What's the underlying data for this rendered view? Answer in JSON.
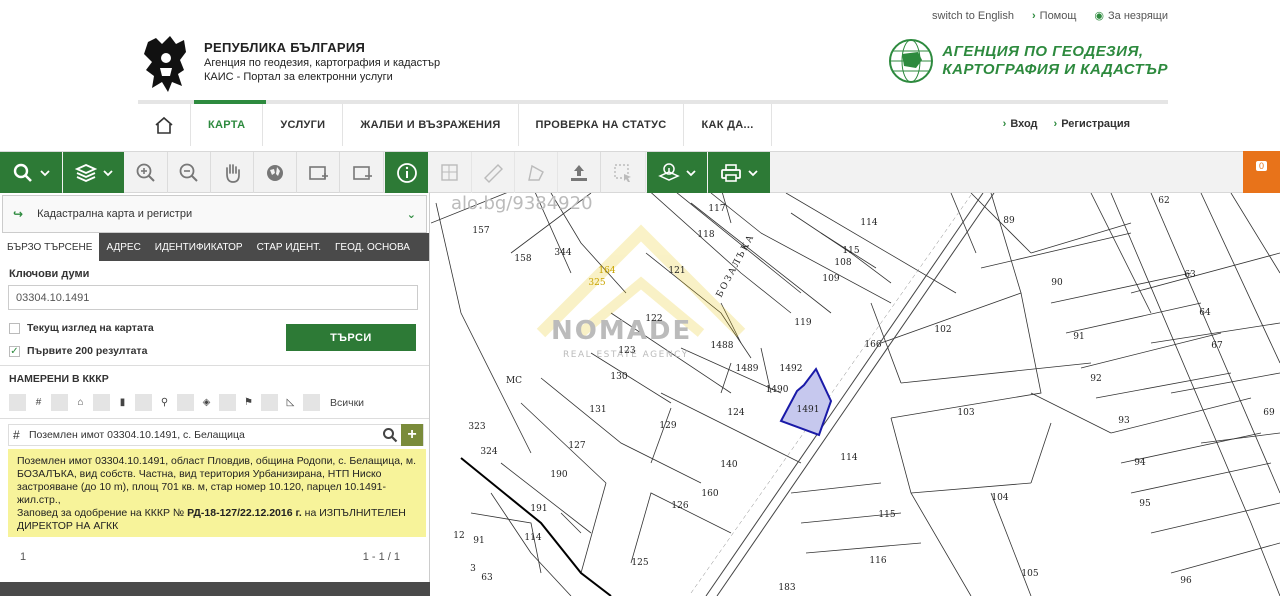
{
  "top_links": {
    "english": "switch to English",
    "help": "Помощ",
    "accessible": "За незрящи"
  },
  "brand": {
    "line1": "РЕПУБЛИКА БЪЛГАРИЯ",
    "line2": "Агенция по геодезия, картография и кадастър",
    "line3": "КАИС - Портал за електронни услуги"
  },
  "agency": {
    "line1": "АГЕНЦИЯ ПО ГЕОДЕЗИЯ,",
    "line2": "КАРТОГРАФИЯ И КАДАСТЪР"
  },
  "nav": {
    "items": [
      "КАРТА",
      "УСЛУГИ",
      "ЖАЛБИ И ВЪЗРАЖЕНИЯ",
      "ПРОВЕРКА НА СТАТУС",
      "КАК ДА..."
    ],
    "active": "КАРТА"
  },
  "auth": {
    "login": "Вход",
    "register": "Регистрация"
  },
  "toolbar": {
    "badge_count": "0"
  },
  "panel": {
    "layer": "Кадастрална карта и регистри",
    "tabs": [
      "БЪРЗО ТЪРСЕНЕ",
      "АДРЕС",
      "ИДЕНТИФИКАТОР",
      "СТАР ИДЕНТ.",
      "ГЕОД. ОСНОВА"
    ],
    "keywords_label": "Ключови думи",
    "keywords_value": "03304.10.1491",
    "check_current": "Текущ изглед на картата",
    "check_first200": "Първите 200 резултата",
    "search_button": "ТЪРСИ",
    "found_label": "НАМЕРЕНИ В КККР",
    "filter_all": "Всички",
    "result_title": "Поземлен имот 03304.10.1491, с. Белащица",
    "info_text": "Поземлен имот 03304.10.1491, област Пловдив, община Родопи, с. Белащица, м. БОЗАЛЪКА, вид собств. Частна, вид територия Урбанизирана, НТП Ниско застрояване (до 10 m), площ 701 кв. м, стар номер 10.120, парцел 10.1491-жил.стр.,",
    "info_order_prefix": "Заповед за одобрение на КККР №",
    "info_order_no": "РД-18-127/22.12.2016 г.",
    "info_order_suffix": "на ИЗПЪЛНИТЕЛЕН ДИРЕКТОР НА АГКК",
    "page": "1",
    "page_range": "1 - 1 / 1"
  },
  "map": {
    "watermark_top": "alo.bg/9384920",
    "watermark_logo": "NOMADE",
    "watermark_sub": "REAL ESTATE AGENCY",
    "street_label": "БОЗАЛЪКА",
    "highlight_parcel": "1491",
    "parcel_labels": [
      "157",
      "158",
      "344",
      "164",
      "325",
      "117",
      "118",
      "121",
      "114",
      "115",
      "108",
      "109",
      "89",
      "62",
      "90",
      "63",
      "64",
      "67",
      "119",
      "122",
      "102",
      "91",
      "123",
      "1488",
      "1489",
      "1492",
      "166",
      "92",
      "69",
      "130",
      "1490",
      "131",
      "124",
      "1491",
      "103",
      "93",
      "МС",
      "323",
      "324",
      "129",
      "114",
      "94",
      "127",
      "140",
      "160",
      "190",
      "126",
      "104",
      "95",
      "191",
      "115",
      "125",
      "116",
      "105",
      "96",
      "183",
      "12",
      "91",
      "114",
      "3",
      "63"
    ],
    "highlight_color": "#c6c8ee"
  }
}
